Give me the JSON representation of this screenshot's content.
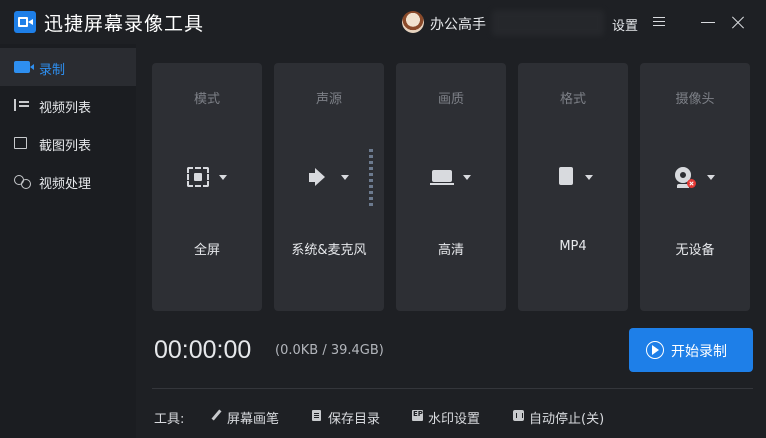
{
  "app": {
    "title": "迅捷屏幕录像工具",
    "user_name": "办公高手",
    "settings_label": "设置"
  },
  "sidebar": {
    "items": [
      {
        "label": "录制",
        "icon": "record-icon",
        "active": true
      },
      {
        "label": "视频列表",
        "icon": "video-list-icon",
        "active": false
      },
      {
        "label": "截图列表",
        "icon": "screenshot-list-icon",
        "active": false
      },
      {
        "label": "视频处理",
        "icon": "video-edit-icon",
        "active": false
      }
    ]
  },
  "cards": [
    {
      "title": "模式",
      "value": "全屏",
      "icon": "fullscreen-mode-icon"
    },
    {
      "title": "声源",
      "value": "系统&麦克风",
      "icon": "speaker-icon"
    },
    {
      "title": "画质",
      "value": "高清",
      "icon": "laptop-icon"
    },
    {
      "title": "格式",
      "value": "MP4",
      "icon": "file-format-icon"
    },
    {
      "title": "摄像头",
      "value": "无设备",
      "icon": "camera-icon"
    }
  ],
  "recording": {
    "timer": "00:00:00",
    "size_info": "(0.0KB / 39.4GB)",
    "start_label": "开始录制"
  },
  "tools": {
    "label": "工具:",
    "items": [
      {
        "label": "屏幕画笔",
        "icon": "pen-icon"
      },
      {
        "label": "保存目录",
        "icon": "folder-doc-icon"
      },
      {
        "label": "水印设置",
        "icon": "watermark-icon"
      },
      {
        "label": "自动停止(关)",
        "icon": "auto-stop-icon"
      }
    ]
  },
  "colors": {
    "accent": "#1e7fe8",
    "background": "#1e2024",
    "card": "#2d2f34",
    "error_badge": "#e53935"
  }
}
